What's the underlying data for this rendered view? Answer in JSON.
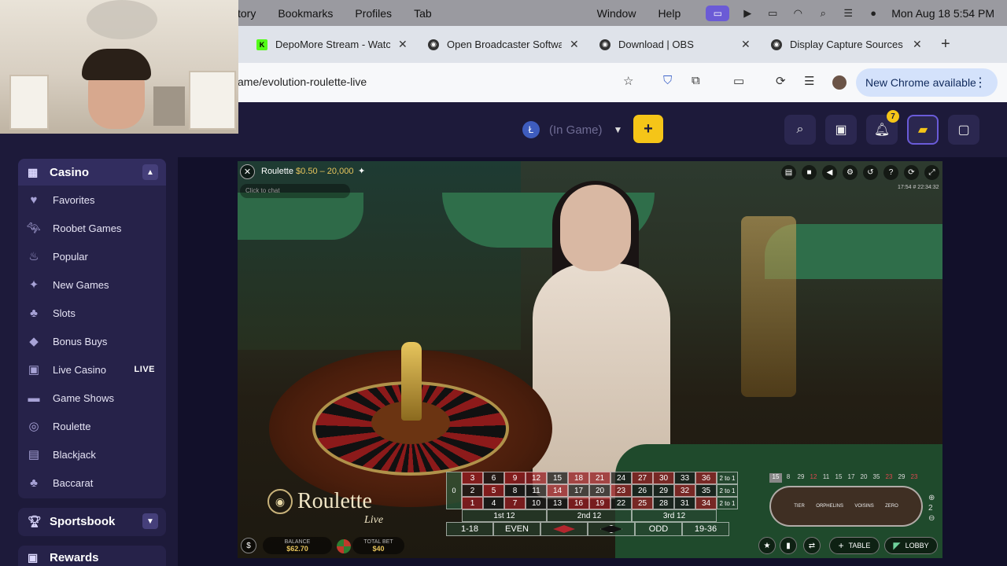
{
  "menubar": {
    "items": [
      "tory",
      "Bookmarks",
      "Profiles",
      "Tab"
    ],
    "right_items": [
      "Window",
      "Help"
    ],
    "datetime": "Mon Aug 18  5:54 PM"
  },
  "browser": {
    "tabs": [
      {
        "title": "DepoMore Stream - Watch",
        "favicon": "K"
      },
      {
        "title": "Open Broadcaster Softwa",
        "favicon": "obs"
      },
      {
        "title": "Download | OBS",
        "favicon": "obs"
      },
      {
        "title": "Display Capture Sources",
        "favicon": "obs"
      }
    ],
    "url": "ame/evolution-roulette-live",
    "chrome_update": "New Chrome available"
  },
  "header": {
    "status": "(In Game)",
    "notif_count": "7"
  },
  "sidebar": {
    "casino_label": "Casino",
    "items": [
      {
        "label": "Favorites",
        "icon": "heart-icon"
      },
      {
        "label": "Roobet Games",
        "icon": "roo-icon"
      },
      {
        "label": "Popular",
        "icon": "flame-icon"
      },
      {
        "label": "New Games",
        "icon": "sparkle-icon"
      },
      {
        "label": "Slots",
        "icon": "cherries-icon"
      },
      {
        "label": "Bonus Buys",
        "icon": "bonus-icon"
      },
      {
        "label": "Live Casino",
        "icon": "live-icon",
        "badge": "LIVE"
      },
      {
        "label": "Game Shows",
        "icon": "tv-icon"
      },
      {
        "label": "Roulette",
        "icon": "roulette-icon"
      },
      {
        "label": "Blackjack",
        "icon": "cards-icon"
      },
      {
        "label": "Baccarat",
        "icon": "club-icon"
      }
    ],
    "sportsbook_label": "Sportsbook",
    "rewards_label": "Rewards"
  },
  "game": {
    "title": "Roulette",
    "limits": "$0.50 – 20,000",
    "chat_placeholder": "Click to chat",
    "time": "17:54 # 22:34:32",
    "logo_text": "Roulette",
    "logo_sub": "Live",
    "balance_label": "BALANCE",
    "balance_value": "$62.70",
    "total_bet_label": "TOTAL BET",
    "total_bet_value": "$40",
    "table_label": "TABLE",
    "lobby_label": "LOBBY",
    "dozens": [
      "1st 12",
      "2nd 12",
      "3rd 12"
    ],
    "outside": [
      "1-18",
      "EVEN",
      "",
      "",
      "ODD",
      "19-36"
    ],
    "zero": "0",
    "column_label": "2 to 1",
    "grid_rows": [
      [
        "3",
        "6",
        "9",
        "12",
        "15",
        "18",
        "21",
        "24",
        "27",
        "30",
        "33",
        "36"
      ],
      [
        "2",
        "5",
        "8",
        "11",
        "14",
        "17",
        "20",
        "23",
        "26",
        "29",
        "32",
        "35"
      ],
      [
        "1",
        "4",
        "7",
        "10",
        "13",
        "16",
        "19",
        "22",
        "25",
        "28",
        "31",
        "34"
      ]
    ],
    "history": [
      "15",
      "8",
      "29",
      "12",
      "11",
      "15",
      "17",
      "20",
      "35",
      "23",
      "29",
      "23"
    ],
    "racetrack_labels": [
      "TIER",
      "ORPHELINS",
      "VOISINS",
      "ZERO"
    ],
    "side_counter": "2"
  }
}
